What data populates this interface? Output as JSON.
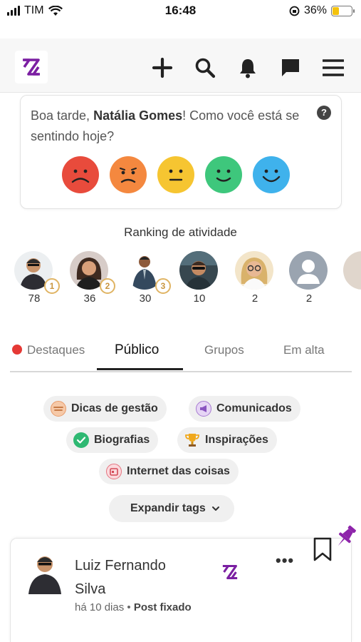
{
  "status_bar": {
    "carrier": "TIM",
    "time": "16:48",
    "battery": "36%",
    "battery_level": 0.36
  },
  "header": {
    "logo": "zorp-logo",
    "icons": [
      "plus-icon",
      "search-icon",
      "bell-icon",
      "chat-icon",
      "menu-icon"
    ]
  },
  "mood": {
    "greeting_prefix": "Boa tarde,",
    "user_name": "Natália Gomes",
    "greeting_suffix": "! Como você está se sentindo hoje?",
    "help": "?",
    "faces": [
      {
        "name": "very-sad",
        "color": "#e84b3c"
      },
      {
        "name": "sad",
        "color": "#f4883f"
      },
      {
        "name": "neutral",
        "color": "#f6c531"
      },
      {
        "name": "happy",
        "color": "#3ec77c"
      },
      {
        "name": "very-happy",
        "color": "#3fb2ec"
      }
    ]
  },
  "ranking": {
    "title": "Ranking de atividade",
    "items": [
      {
        "position": "1",
        "score": "78"
      },
      {
        "position": "2",
        "score": "36"
      },
      {
        "position": "3",
        "score": "30"
      },
      {
        "position": "",
        "score": "10"
      },
      {
        "position": "",
        "score": "2"
      },
      {
        "position": "",
        "score": "2"
      }
    ]
  },
  "tabs": [
    {
      "label": "Destaques"
    },
    {
      "label": "Público"
    },
    {
      "label": "Grupos"
    },
    {
      "label": "Em alta"
    }
  ],
  "tags": [
    {
      "label": "Dicas de gestão"
    },
    {
      "label": "Comunicados"
    },
    {
      "label": "Biografias"
    },
    {
      "label": "Inspirações"
    },
    {
      "label": "Internet das coisas"
    }
  ],
  "expand_tags": "Expandir tags",
  "post": {
    "author_line1": "Luiz Fernando",
    "author_line2": "Silva",
    "time": "há 10 dias",
    "separator": "•",
    "status": "Post fixado",
    "more": "•••"
  },
  "colors": {
    "brand": "#7b1fa2",
    "accent": "#8e24aa",
    "destaque_dot": "#e53935"
  }
}
